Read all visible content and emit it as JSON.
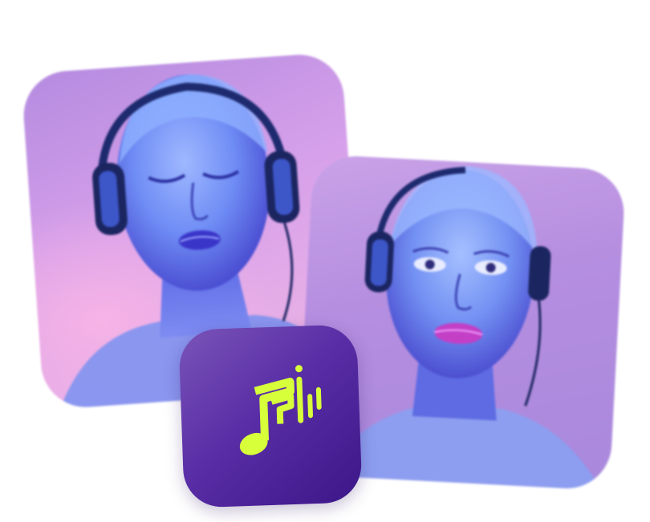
{
  "artwork": {
    "left_card": {
      "subject": "woman-with-headphones-eyes-closed"
    },
    "right_card": {
      "subject": "woman-with-headphones-looking-forward"
    },
    "app_icon": {
      "symbol": "music-note-with-sound-bars"
    }
  },
  "colors": {
    "icon_glyph": "#d7ff3a",
    "icon_background_top": "#7a54b8",
    "icon_background_bottom": "#3c1688",
    "card_gradient_purple": "#b58be0",
    "card_gradient_pink": "#f2b8e4",
    "skin_blue": "#6f8df5"
  }
}
